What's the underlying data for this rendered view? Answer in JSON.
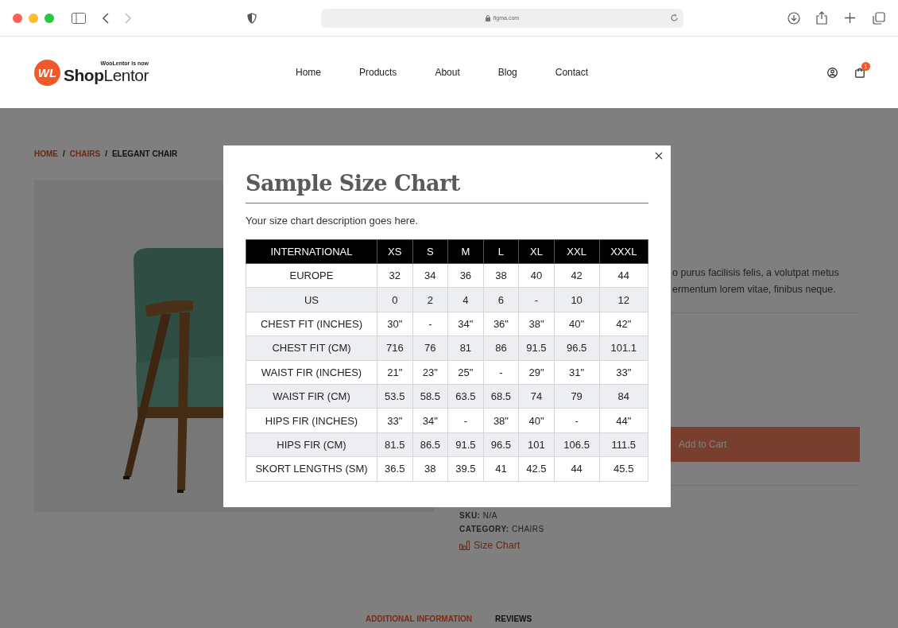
{
  "browser": {
    "url": "figma.com"
  },
  "header": {
    "logo": {
      "mark": "WL",
      "tagline": "WooLentor is now",
      "brand": "**Shop**Lentor"
    },
    "nav": [
      {
        "label": "Home"
      },
      {
        "label": "Products"
      },
      {
        "label": "About"
      },
      {
        "label": "Blog"
      },
      {
        "label": "Contact"
      }
    ],
    "cart_badge": "1"
  },
  "breadcrumb_separator": "/",
  "breadcrumb": [
    {
      "label": "HOME",
      "current": false
    },
    {
      "label": "CHAIRS",
      "current": false
    },
    {
      "label": "ELEGANT CHAIR",
      "current": true
    }
  ],
  "product": {
    "description_lines": [
      "o purus facilisis felis, a volutpat metus",
      "ermentum lorem vitae, finibus neque."
    ],
    "add_to_cart": "Add to Cart",
    "meta": [
      {
        "label": "SKU:",
        "value": "N/A"
      },
      {
        "label": "CATEGORY:",
        "value": "CHAIRS"
      }
    ],
    "size_chart_link": "Size Chart"
  },
  "tabs": [
    {
      "label": "ADDITIONAL INFORMATION",
      "selected": true
    },
    {
      "label": "REVIEWS",
      "selected": false
    }
  ],
  "modal": {
    "title": "Sample Size Chart",
    "description": "Your size chart description goes here.",
    "table": {
      "columns": [
        "INTERNATIONAL",
        "XS",
        "S",
        "M",
        "L",
        "XL",
        "XXL",
        "XXXL"
      ],
      "rows": [
        [
          "EUROPE",
          "32",
          "34",
          "36",
          "38",
          "40",
          "42",
          "44"
        ],
        [
          "US",
          "0",
          "2",
          "4",
          "6",
          "-",
          "10",
          "12"
        ],
        [
          "CHEST FIT (INCHES)",
          "30\"",
          "-",
          "34\"",
          "36\"",
          "38\"",
          "40\"",
          "42\""
        ],
        [
          "CHEST FIT (CM)",
          "716",
          "76",
          "81",
          "86",
          "91.5",
          "96.5",
          "101.1"
        ],
        [
          "WAIST FIR (INCHES)",
          "21\"",
          "23\"",
          "25\"",
          "-",
          "29\"",
          "31\"",
          "33\""
        ],
        [
          "WAIST FIR (CM)",
          "53.5",
          "58.5",
          "63.5",
          "68.5",
          "74",
          "79",
          "84"
        ],
        [
          "HIPS FIR (INCHES)",
          "33\"",
          "34\"",
          "-",
          "38\"",
          "40\"",
          "-",
          "44\""
        ],
        [
          "HIPS FIR (CM)",
          "81.5",
          "86.5",
          "91.5",
          "96.5",
          "101",
          "106.5",
          "111.5"
        ],
        [
          "SKORT LENGTHS (SM)",
          "36.5",
          "38",
          "39.5",
          "41",
          "42.5",
          "44",
          "45.5"
        ]
      ]
    }
  }
}
